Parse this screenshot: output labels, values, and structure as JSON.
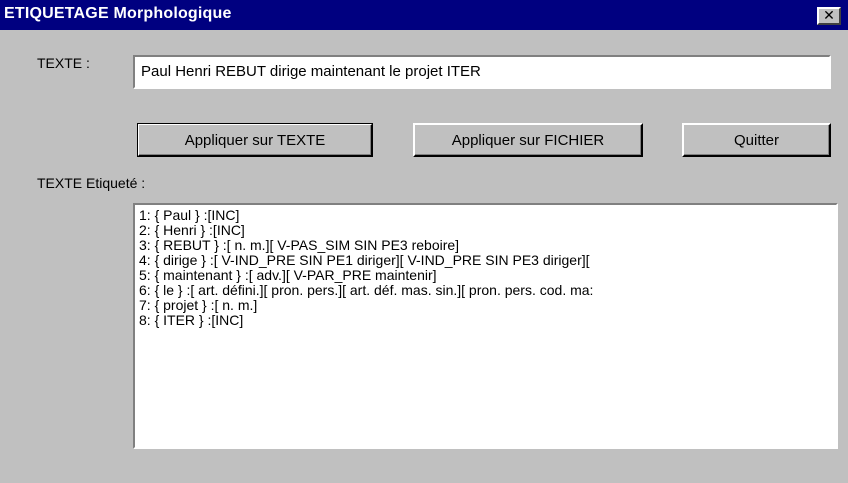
{
  "window": {
    "title": "ETIQUETAGE Morphologique",
    "close_glyph": "✕",
    "close_icon": "close-icon"
  },
  "texte": {
    "label": "TEXTE :",
    "value": "Paul Henri REBUT dirige maintenant le projet ITER"
  },
  "buttons": {
    "apply_text": "Appliquer sur TEXTE",
    "apply_file": "Appliquer sur FICHIER",
    "quit": "Quitter"
  },
  "output": {
    "label": "TEXTE Etiqueté :",
    "lines": [
      "1: { Paul } :[INC]",
      "2: { Henri } :[INC]",
      "3: { REBUT } :[ n. m.][ V-PAS_SIM SIN PE3 reboire]",
      "4: { dirige } :[ V-IND_PRE SIN PE1 diriger][ V-IND_PRE SIN PE3 diriger][",
      "5: { maintenant } :[ adv.][ V-PAR_PRE maintenir]",
      "6: { le } :[ art. défini.][ pron. pers.][ art. déf. mas. sin.][ pron. pers. cod. ma:",
      "7: { projet } :[ n. m.]",
      "8: { ITER } :[INC]"
    ]
  },
  "colors": {
    "titlebar": "#000080",
    "face": "#c0c0c0"
  }
}
